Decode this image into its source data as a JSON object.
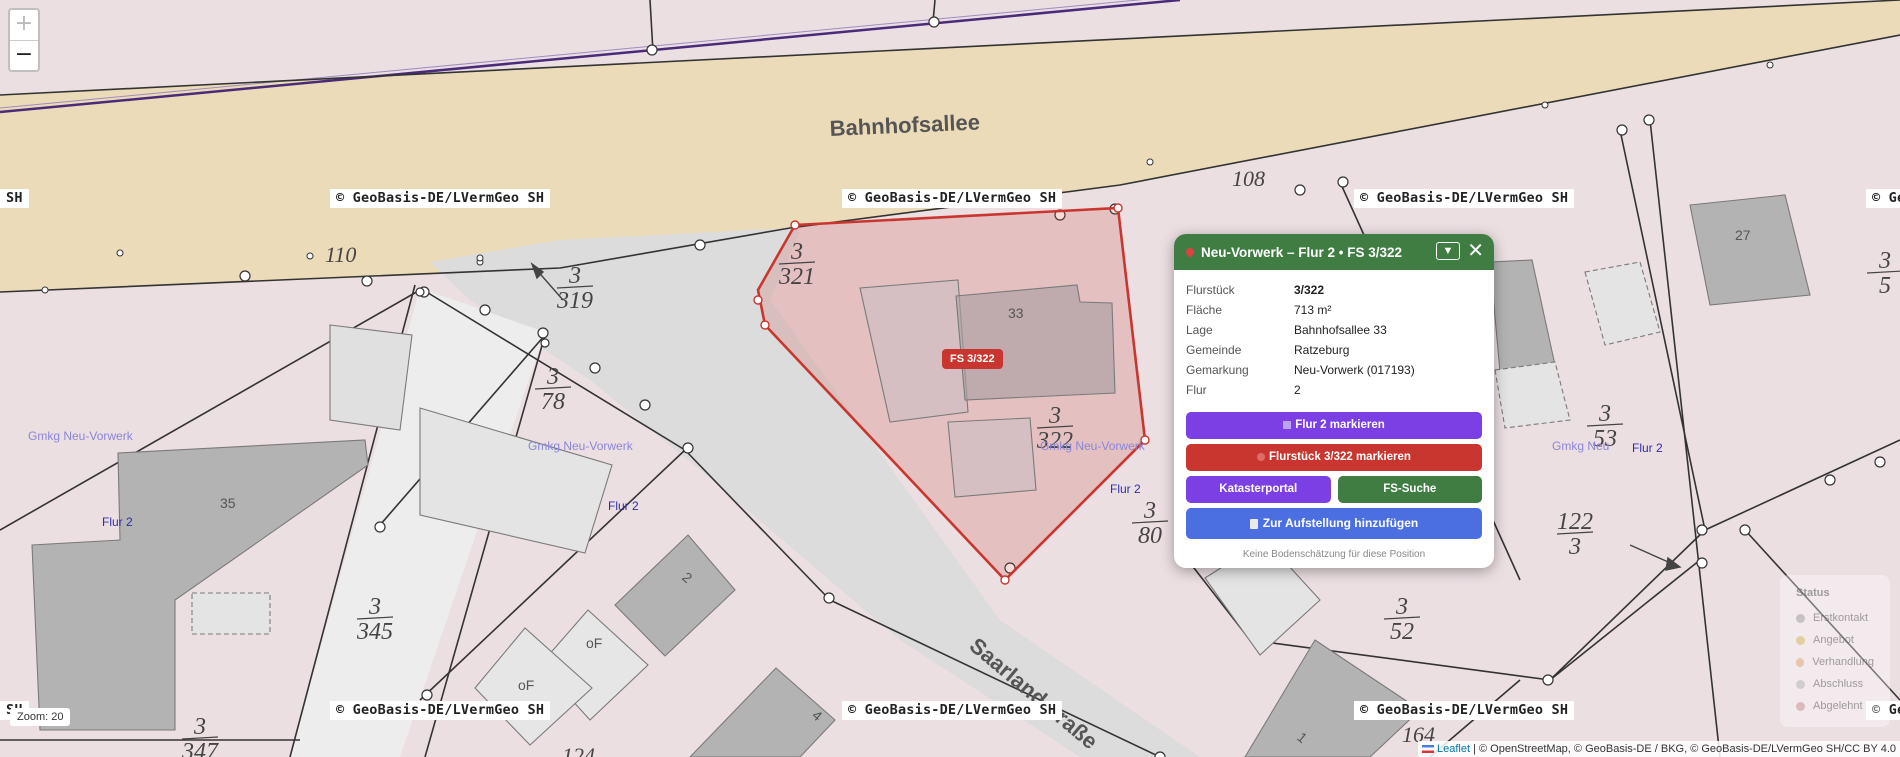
{
  "map": {
    "street_labels": {
      "bahnhofsallee": "Bahnhofsallee",
      "saarlandstrasse": "Saarlandstraße"
    },
    "house_numbers": {
      "h110": "110",
      "h108": "108",
      "h164": "164",
      "h124": "124",
      "b33": "33",
      "b35": "35",
      "b27": "27",
      "b2": "2",
      "b4": "4",
      "b1": "1",
      "of1": "oF",
      "of2": "oF"
    },
    "parcels": {
      "p3_319": {
        "num": "3",
        "den": "319"
      },
      "p3_321": {
        "num": "3",
        "den": "321"
      },
      "p3_78": {
        "num": "3",
        "den": "78"
      },
      "p3_322": {
        "num": "3",
        "den": "322"
      },
      "p3_80": {
        "num": "3",
        "den": "80"
      },
      "p3_345": {
        "num": "3",
        "den": "345"
      },
      "p3_347": {
        "num": "3",
        "den": "347"
      },
      "p3_52": {
        "num": "3",
        "den": "52"
      },
      "p3_53": {
        "num": "3",
        "den": "53"
      },
      "p122_3": {
        "num": "122",
        "den": "3"
      },
      "p3_5": {
        "num": "3",
        "den": "5"
      }
    },
    "gemarkung_labels": {
      "g1": "Gmkg Neu-Vorwerk",
      "g2": "Gmkg Neu-Vorwerk",
      "g3": "Gmkg Neu-Vorwerk",
      "g4": "Gmkg Neu"
    },
    "flur_labels": {
      "f1": "Flur 2",
      "f2": "Flur 2",
      "f3": "Flur 2",
      "f4": "Flur 2"
    },
    "selected_label": "FS 3/322",
    "copyright_stamp": "© GeoBasis-DE/LVermGeo SH",
    "stamp_fragment_left": "SH",
    "stamp_fragment_right": "© Ge",
    "colors": {
      "street": "#ecdbb8",
      "road_gray": "#dcdcdc",
      "ground": "#ecdfe2",
      "building": "#b3b3b3",
      "selection": "#c9362f",
      "purple_line": "#4b2a7a"
    }
  },
  "zoom": {
    "in_label": "+",
    "out_label": "−",
    "level_text": "Zoom: 20"
  },
  "attribution": {
    "leaflet": "Leaflet",
    "text": " | © OpenStreetMap, © GeoBasis-DE / BKG, © GeoBasis-DE/LVermGeo SH/CC BY 4.0"
  },
  "legend": {
    "title": "Status",
    "items": [
      {
        "label": "Erstkontakt",
        "color": "#9a9a9a"
      },
      {
        "label": "Angebot",
        "color": "#d4b24c"
      },
      {
        "label": "Verhandlung",
        "color": "#e0a070"
      },
      {
        "label": "Abschluss",
        "color": "#b0b0b0"
      },
      {
        "label": "Abgelehnt",
        "color": "#c48a8a"
      }
    ]
  },
  "popup": {
    "title": "Neu-Vorwerk – Flur 2 • FS 3/322",
    "collapse_icon": "▼",
    "close_icon": "✕",
    "rows": [
      {
        "key": "Flurstück",
        "value": "3/322"
      },
      {
        "key": "Fläche",
        "value": "713 m²"
      },
      {
        "key": "Lage",
        "value": "Bahnhofsallee 33"
      },
      {
        "key": "Gemeinde",
        "value": "Ratzeburg"
      },
      {
        "key": "Gemarkung",
        "value": "Neu-Vorwerk (017193)"
      },
      {
        "key": "Flur",
        "value": "2"
      }
    ],
    "buttons": {
      "flur_mark": "Flur 2 markieren",
      "fs_mark": "Flurstück 3/322 markieren",
      "kataster": "Katasterportal",
      "fs_search": "FS-Suche",
      "add_list": "Zur Aufstellung hinzufügen"
    },
    "note": "Keine Bodenschätzung für diese Position"
  }
}
